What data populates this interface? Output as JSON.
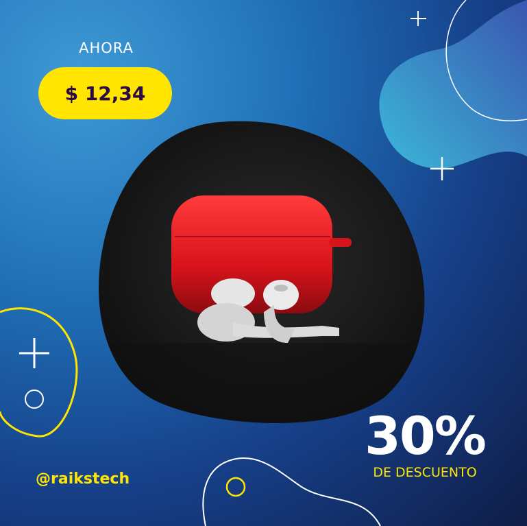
{
  "ahora_label": "AHORA",
  "price": "$ 12,34",
  "discount": {
    "percent": "30%",
    "label": "DE DESCUENTO"
  },
  "handle": "@raikstech",
  "colors": {
    "accent_yellow": "#ffe500",
    "price_text": "#2b0a4a",
    "product_red": "#e8181f"
  }
}
